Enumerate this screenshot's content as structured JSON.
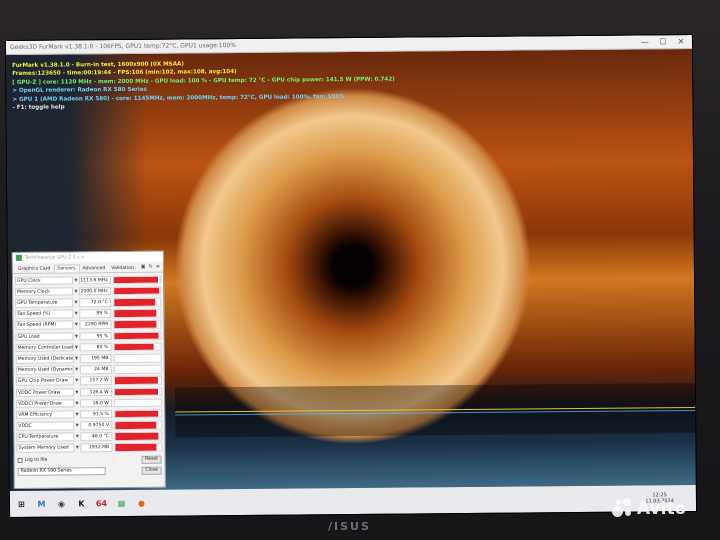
{
  "furmark": {
    "title": "Geeks3D FurMark v1.38.1.0 - 106FPS, GPU1 temp:72°C, GPU1 usage:100%",
    "stats": [
      "FurMark v1.38.1.0 - Burn-in test, 1600x900 (0X MSAA)",
      "Frames:123650 - time:00:19:44 - FPS:106 (min:102, max:108, avg:104)",
      "[ GPU-Z ] core: 1120 MHz - mem: 2000 MHz - GPU load: 100 % - GPU temp: 72 °C - GPU chip power: 141.5 W (PPW: 0.742)",
      "> OpenGL renderer: Radeon RX 580 Series",
      "> GPU 1 (AMD Radeon RX 580) - core: 1145MHz, mem: 2000MHz, temp: 72°C, GPU load: 100%, fan: 101%",
      "- F1: toggle help"
    ]
  },
  "gpuz": {
    "title": "TechPowerUp GPU-Z 2.x.x",
    "tabs": [
      "Graphics Card",
      "Sensors",
      "Advanced",
      "Validation"
    ],
    "active_tab": "Sensors",
    "sensors": [
      {
        "label": "GPU Clock",
        "value": "1113.6 MHz",
        "fill": 0.95
      },
      {
        "label": "Memory Clock",
        "value": "2000.0 MHz",
        "fill": 0.97
      },
      {
        "label": "GPU Temperature",
        "value": "72.0 °C",
        "fill": 0.9
      },
      {
        "label": "Fan Speed (%)",
        "value": "89 %",
        "fill": 0.92
      },
      {
        "label": "Fan Speed (RPM)",
        "value": "2290 RPM",
        "fill": 0.92
      },
      {
        "label": "GPU Load",
        "value": "95 %",
        "fill": 0.95
      },
      {
        "label": "Memory Controller Load",
        "value": "80 %",
        "fill": 0.85
      },
      {
        "label": "Memory Used (Dedicated)",
        "value": "195 MB",
        "fill": 0.0
      },
      {
        "label": "Memory Used (Dynamic)",
        "value": "24 MB",
        "fill": 0.0
      },
      {
        "label": "GPU Chip Power Draw",
        "value": "157.2 W",
        "fill": 0.93
      },
      {
        "label": "VDDC Power Draw",
        "value": "126.4 W",
        "fill": 0.93
      },
      {
        "label": "VDDCI Power Draw",
        "value": "16.0 W",
        "fill": 0.0
      },
      {
        "label": "VRM Efficiency",
        "value": "91.5 %",
        "fill": 0.93
      },
      {
        "label": "VDDC",
        "value": "0.9750 V",
        "fill": 0.9
      },
      {
        "label": "CPU Temperature",
        "value": "46.0 °C",
        "fill": 0.93
      },
      {
        "label": "System Memory Used",
        "value": "1932 MB",
        "fill": 0.9
      }
    ],
    "log_label": "Log to file",
    "reset_label": "Reset",
    "gpu_select": "Radeon RX 580 Series",
    "close_label": "Close"
  },
  "taskbar": {
    "icons": [
      {
        "name": "start-icon",
        "glyph": "⊞",
        "color": "#1a1a1a"
      },
      {
        "name": "mail-icon",
        "glyph": "M",
        "color": "#2b6fd4"
      },
      {
        "name": "chat-icon",
        "glyph": "◉",
        "color": "#3a3a3a"
      },
      {
        "name": "k-app-icon",
        "glyph": "K",
        "color": "#1a1a1a"
      },
      {
        "name": "aida64-icon",
        "glyph": "64",
        "color": "#c9242b"
      },
      {
        "name": "gpuz-icon",
        "glyph": "▦",
        "color": "#3aa04a"
      },
      {
        "name": "furmark-icon",
        "glyph": "●",
        "color": "#e06a12"
      }
    ],
    "clock_time": "12:25",
    "clock_date": "11.03.2024"
  },
  "bezel_brand": "/ISUS",
  "watermark": "Avito",
  "colors": {
    "accent_red": "#e2232a",
    "fm_yellow": "#f4ef3a"
  }
}
